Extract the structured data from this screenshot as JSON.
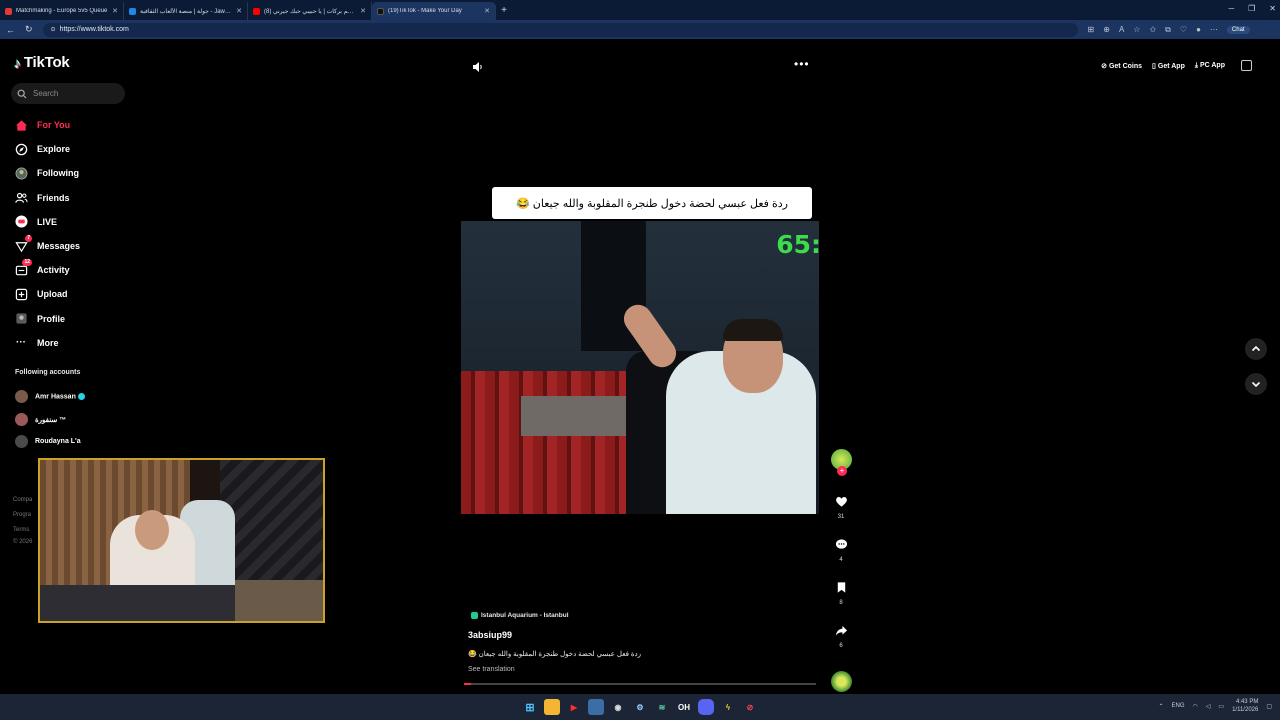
{
  "browser": {
    "tabs": [
      {
        "title": "Matchmaking - Europe 5v5 Queue",
        "color": "#e53935",
        "active": false
      },
      {
        "title": "جولة | منصة الألعاب الثقافية - Jawlah",
        "color": "#1e88e5",
        "active": false
      },
      {
        "title": "(8) ملحم بركات | يا حبيبي حبك جيرني",
        "color": "#ff0000",
        "active": false
      },
      {
        "title": "(19)TikTok - Make Your Day",
        "color": "#111111",
        "active": true
      }
    ],
    "new_tab": "+",
    "url": "https://www.tiktok.com",
    "chat_label": "Chat"
  },
  "sidebar": {
    "logo_text": "TikTok",
    "search_placeholder": "Search",
    "items": [
      {
        "label": "For You",
        "icon": "home-icon",
        "active": true
      },
      {
        "label": "Explore",
        "icon": "compass-icon",
        "active": false
      },
      {
        "label": "Following",
        "icon": "following-avatar-icon",
        "active": false
      },
      {
        "label": "Friends",
        "icon": "friends-icon",
        "active": false
      },
      {
        "label": "LIVE",
        "icon": "live-icon",
        "active": false
      },
      {
        "label": "Messages",
        "icon": "messages-icon",
        "active": false,
        "badge": "7"
      },
      {
        "label": "Activity",
        "icon": "activity-icon",
        "active": false,
        "badge": "12"
      },
      {
        "label": "Upload",
        "icon": "upload-icon",
        "active": false
      },
      {
        "label": "Profile",
        "icon": "profile-icon",
        "active": false
      },
      {
        "label": "More",
        "icon": "more-icon",
        "active": false
      }
    ],
    "following_header": "Following accounts",
    "following": [
      {
        "name": "Amr Hassan",
        "verified": true,
        "avatar_color": "#7a5a4a"
      },
      {
        "name": "سنفورة ™",
        "verified": false,
        "avatar_color": "#9a5a5a"
      },
      {
        "name": "Roudayna L'a",
        "verified": false,
        "avatar_color": "#4a4a4a"
      }
    ],
    "footer": [
      "Compa",
      "Progra",
      "Terms",
      "© 2026"
    ]
  },
  "header": {
    "get_coins": "Get Coins",
    "get_app": "Get App",
    "pc_app": "PC App"
  },
  "video": {
    "caption": "ردة فعل عبسي لحضة دخول طنجرة المقلوبة والله جيعان 😂",
    "timer_text": "65:",
    "location": "Istanbul Aquarium - Istanbul",
    "username": "3absiup99",
    "description": "ردة فعل عبسي لحضة دخول طنجرة المقلوبة والله جيعان 😂",
    "see_translation": "See translation",
    "progress": 0.02
  },
  "actions": {
    "likes": "31",
    "comments": "4",
    "saves": "8",
    "shares": "6"
  },
  "taskbar": {
    "language": "ENG",
    "time": "4:43 PM",
    "date": "1/11/2026"
  }
}
